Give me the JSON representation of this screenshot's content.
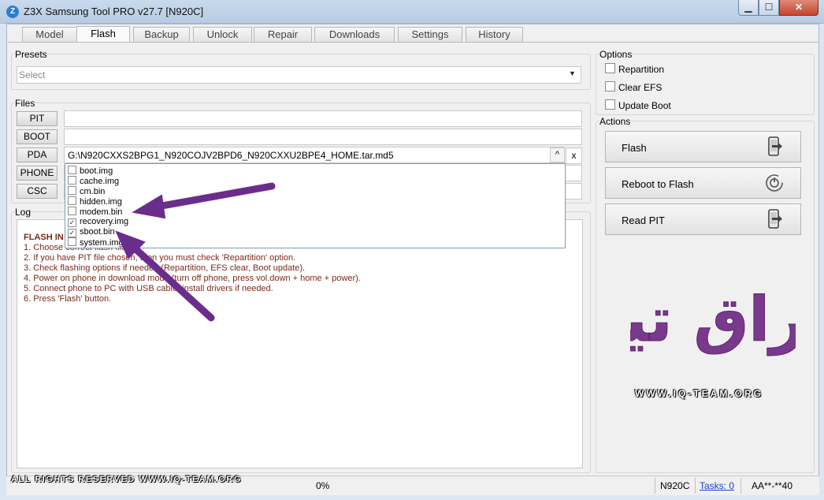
{
  "window": {
    "title": "Z3X Samsung Tool PRO v27.7 [N920C]",
    "controls": {
      "minimize": "▁",
      "maximize": "☐",
      "close": "✕"
    }
  },
  "tabs": [
    {
      "label": "Model"
    },
    {
      "label": "Flash",
      "active": true
    },
    {
      "label": "Backup"
    },
    {
      "label": "Unlock"
    },
    {
      "label": "Repair"
    },
    {
      "label": "Downloads"
    },
    {
      "label": "Settings"
    },
    {
      "label": "History"
    }
  ],
  "presets": {
    "label": "Presets",
    "placeholder": "Select"
  },
  "files": {
    "label": "Files",
    "rows": [
      {
        "button": "PIT",
        "value": ""
      },
      {
        "button": "BOOT",
        "value": ""
      },
      {
        "button": "PDA",
        "value": "G:\\N920CXXS2BPG1_N920COJV2BPD6_N920CXXU2BPE4_HOME.tar.md5"
      },
      {
        "button": "PHONE",
        "value": ""
      },
      {
        "button": "CSC",
        "value": ""
      }
    ],
    "clear_label": "x",
    "expand_label": "^"
  },
  "dropdown_items": [
    {
      "name": "boot.img",
      "checked": false
    },
    {
      "name": "cache.img",
      "checked": false
    },
    {
      "name": "cm.bin",
      "checked": false
    },
    {
      "name": "hidden.img",
      "checked": false
    },
    {
      "name": "modem.bin",
      "checked": false
    },
    {
      "name": "recovery.img",
      "checked": true
    },
    {
      "name": "sboot.bin",
      "checked": true
    },
    {
      "name": "system.img",
      "checked": false
    }
  ],
  "log": {
    "label": "Log",
    "title": "FLASH IN",
    "lines": [
      "1. Choose correct flash file",
      "2. If you have PIT file chosen, then you must check 'Repartition' option.",
      "3. Check flashing options if needed (Repartition, EFS clear, Boot update).",
      "4. Power on phone in download mode (turn off phone, press vol.down + home + power).",
      "5. Connect phone to PC with USB cable, install drivers if needed.",
      "6. Press 'Flash' button."
    ]
  },
  "options": {
    "label": "Options",
    "items": [
      {
        "label": "Repartition",
        "checked": false
      },
      {
        "label": "Clear EFS",
        "checked": false
      },
      {
        "label": "Update Boot",
        "checked": false
      }
    ]
  },
  "actions": {
    "label": "Actions",
    "buttons": [
      {
        "label": "Flash",
        "icon": "phone-arrow-icon"
      },
      {
        "label": "Reboot to Flash",
        "icon": "power-refresh-icon"
      },
      {
        "label": "Read PIT",
        "icon": "phone-arrow-icon"
      }
    ]
  },
  "watermark": {
    "logo_text": "عراق تيم",
    "url": "WWW.IQ-TEAM.ORG",
    "copyright": "ALL RIGHTS RESERVED WWW.IQ-TEAM.ORG",
    "color": "#7a3a8c"
  },
  "status": {
    "progress": "0%",
    "model": "N920C",
    "tasks": "Tasks: 0",
    "serial": "AA**-**40"
  },
  "colors": {
    "accent_arrow": "#6b2d8c",
    "log_text": "#7a2a1a",
    "link": "#1a3fc8"
  }
}
